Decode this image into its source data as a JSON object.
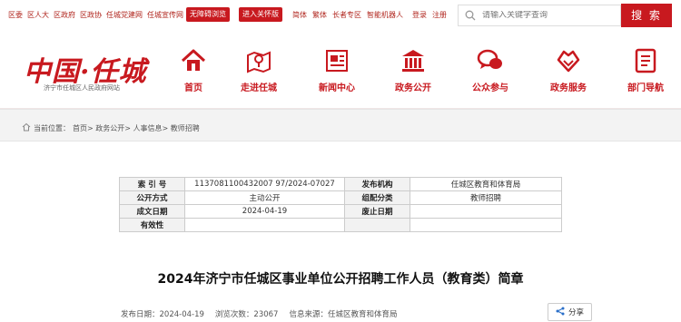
{
  "top": {
    "links": [
      "区委",
      "区人大",
      "区政府",
      "区政协",
      "任城党建网",
      "任城宣传网"
    ],
    "wza_label": "无障碍浏览",
    "care_label": "进入关怀版",
    "tools": [
      "简体",
      "繁体",
      "长者专区",
      "智能机器人",
      "登录",
      "注册"
    ],
    "search_placeholder": "请输入关键字查询",
    "search_button": "搜 索"
  },
  "header": {
    "logo": "中国·任城",
    "logo_sub": "济宁市任城区人民政府网站",
    "nav": [
      {
        "label": "首页",
        "icon": "home-icon"
      },
      {
        "label": "走进任城",
        "icon": "map-pin-icon"
      },
      {
        "label": "新闻中心",
        "icon": "newspaper-icon"
      },
      {
        "label": "政务公开",
        "icon": "government-building-icon"
      },
      {
        "label": "公众参与",
        "icon": "chat-bubbles-icon"
      },
      {
        "label": "政务服务",
        "icon": "heart-hands-icon"
      },
      {
        "label": "部门导航",
        "icon": "document-list-icon"
      }
    ]
  },
  "breadcrumb": {
    "prefix": "当前位置：",
    "path": "首页> 政务公开> 人事信息> 教师招聘"
  },
  "info_table": {
    "rows": [
      {
        "k1": "索 引 号",
        "v1": "11370811004320079 7/2024-07027",
        "k2": "发布机构",
        "v2": "任城区教育和体育局"
      },
      {
        "k1": "公开方式",
        "v1": "主动公开",
        "k2": "组配分类",
        "v2": "教师招聘"
      },
      {
        "k1": "成文日期",
        "v1": "2024-04-19",
        "k2": "废止日期",
        "v2": ""
      },
      {
        "k1": "有效性",
        "v1": "",
        "k2": "",
        "v2": ""
      }
    ]
  },
  "article": {
    "title": "2024年济宁市任城区事业单位公开招聘工作人员（教育类）简章",
    "publish_date": "发布日期：2024-04-19",
    "views": "浏览次数：23067",
    "source": "信息来源：任城区教育和体育局",
    "share_label": "分享"
  },
  "colors": {
    "brand_red": "#c8191f",
    "nav_red": "#c8191f",
    "band_gray": "#f3f3f3"
  }
}
